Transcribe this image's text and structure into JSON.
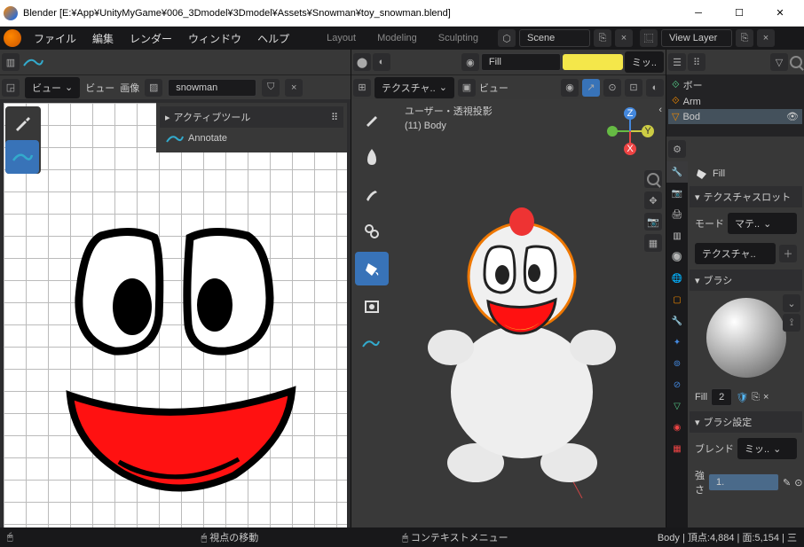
{
  "window": {
    "title": "Blender [E:¥App¥UnityMyGame¥006_3Dmodel¥3Dmodel¥Assets¥Snowman¥toy_snowman.blend]"
  },
  "topmenu": {
    "file": "ファイル",
    "edit": "編集",
    "render": "レンダー",
    "window": "ウィンドウ",
    "help": "ヘルプ"
  },
  "workspace": {
    "layout": "Layout",
    "modeling": "Modeling",
    "sculpting": "Sculpting"
  },
  "scene": {
    "scene_label": "Scene",
    "viewlayer_label": "View Layer"
  },
  "uveditor": {
    "view": "ビュー",
    "view2": "ビュー",
    "image": "画像",
    "image_name": "snowman",
    "active_tool": "アクティブツール",
    "annotate": "Annotate"
  },
  "viewport": {
    "texture_dropdown": "テクスチャ..",
    "view": "ビュー",
    "projection": "ユーザー・透視投影",
    "object": "(11) Body",
    "brush": "Fill",
    "mi": "ミッ.."
  },
  "outliner": {
    "bone": "ボー",
    "arm": "Arm",
    "body": "Bod"
  },
  "props": {
    "fill": "Fill",
    "texture_slot": "テクスチャスロット",
    "mode": "モード",
    "mate": "マテ..",
    "texture": "テクスチャ..",
    "brush": "ブラシ",
    "fill2": "Fill",
    "two": "2",
    "brush_settings": "ブラシ設定",
    "blend": "ブレンド",
    "mix": "ミッ..",
    "strength": "強さ",
    "one": "1."
  },
  "status": {
    "move": "視点の移動",
    "context": "コンテキストメニュー",
    "stats": "Body | 頂点:4,884 | 面:5,154 | 三"
  }
}
